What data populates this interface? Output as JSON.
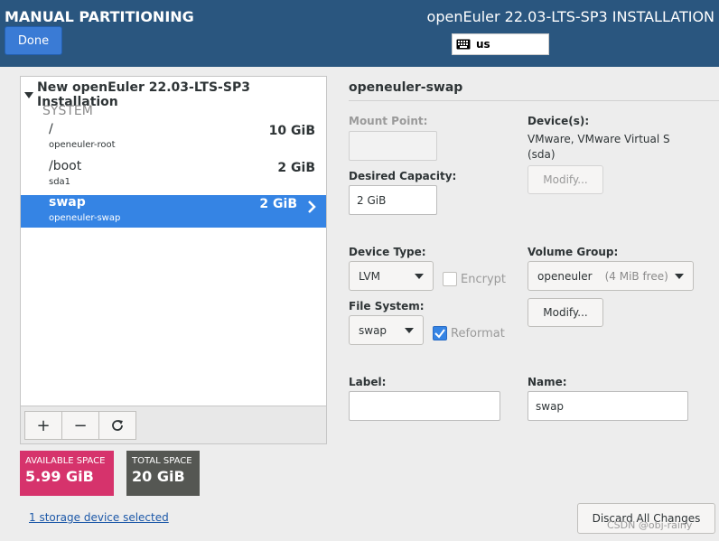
{
  "header": {
    "title": "MANUAL PARTITIONING",
    "done_label": "Done",
    "install_title": "openEuler 22.03-LTS-SP3 INSTALLATION",
    "keyboard_layout": "us"
  },
  "tree": {
    "installation_label": "New openEuler 22.03-LTS-SP3 Installation",
    "group_label": "SYSTEM",
    "partitions": [
      {
        "mount": "/",
        "device": "openeuler-root",
        "size": "10 GiB",
        "selected": false
      },
      {
        "mount": "/boot",
        "device": "sda1",
        "size": "2 GiB",
        "selected": false
      },
      {
        "mount": "swap",
        "device": "openeuler-swap",
        "size": "2 GiB",
        "selected": true
      }
    ]
  },
  "toolbar": {
    "add_symbol": "+",
    "remove_symbol": "−",
    "refresh_symbol": "⟳"
  },
  "space": {
    "available_label": "AVAILABLE SPACE",
    "available_value": "5.99 GiB",
    "total_label": "TOTAL SPACE",
    "total_value": "20 GiB"
  },
  "footer": {
    "storage_link": "1 storage device selected",
    "discard_label": "Discard All Changes",
    "watermark": "CSDN @obj-rainy"
  },
  "details": {
    "title": "openeuler-swap",
    "mount_point_label": "Mount Point:",
    "mount_point_value": "",
    "desired_capacity_label": "Desired Capacity:",
    "desired_capacity_value": "2 GiB",
    "devices_label": "Device(s):",
    "devices_line1": "VMware, VMware Virtual S",
    "devices_line2": "(sda)",
    "devices_modify_label": "Modify...",
    "device_type_label": "Device Type:",
    "device_type_value": "LVM",
    "encrypt_label": "Encrypt",
    "encrypt_checked": false,
    "volume_group_label": "Volume Group:",
    "volume_group_value": "openeuler",
    "volume_group_free": "(4 MiB free)",
    "volume_group_modify_label": "Modify...",
    "file_system_label": "File System:",
    "file_system_value": "swap",
    "reformat_label": "Reformat",
    "reformat_checked": true,
    "label_label": "Label:",
    "label_value": "",
    "name_label": "Name:",
    "name_value": "swap"
  },
  "colors": {
    "header_bg": "#2a567f",
    "accent": "#3584e4",
    "available_bg": "#d6336c",
    "total_bg": "#555753"
  }
}
